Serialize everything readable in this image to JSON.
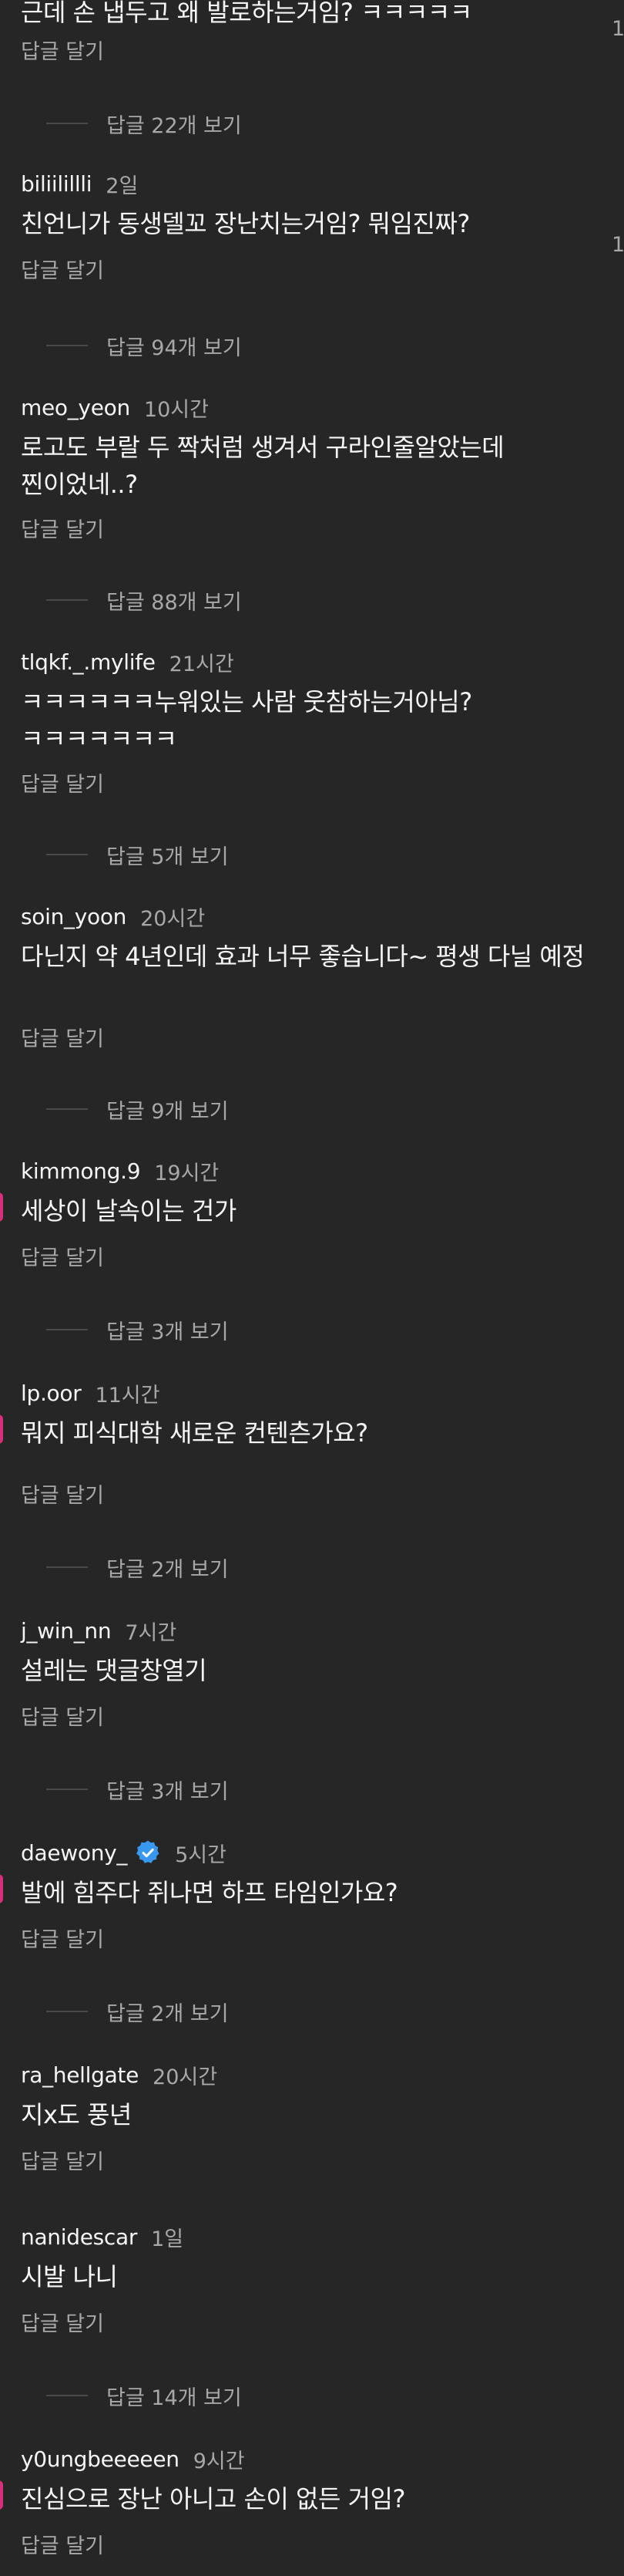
{
  "reply_label": "답글 달기",
  "top_partial": {
    "text": "근데 손 냅두고 왜 발로하는거임? ㅋㅋㅋㅋㅋ",
    "reply_label": "답글 달기",
    "view_replies": "답글 22개 보기",
    "side_count": "1"
  },
  "comments": [
    {
      "username": "biliilillli",
      "time": "2일",
      "text": "친언니가 동생델꼬 장난치는거임? 뭐임진짜?",
      "reply_label": "답글 달기",
      "view_replies": "답글 94개 보기",
      "side_count": "1"
    },
    {
      "username": "meo_yeon",
      "time": "10시간",
      "text": "로고도 부랄 두 짝처럼 생겨서 구라인줄알았는데 찐이었네..?",
      "reply_label": "답글 달기",
      "view_replies": "답글 88개 보기"
    },
    {
      "username": "tlqkf._.mylife",
      "time": "21시간",
      "text": "ㅋㅋㅋㅋㅋㅋ누워있는 사람 웃참하는거아님?ㅋㅋㅋㅋㅋㅋㅋ",
      "reply_label": "답글 달기",
      "view_replies": "답글 5개 보기"
    },
    {
      "username": "soin_yoon",
      "time": "20시간",
      "text": "다닌지 약 4년인데 효과 너무 좋습니다~ 평생 다닐 예정",
      "reply_label": "답글 달기",
      "view_replies": "답글 9개 보기"
    },
    {
      "username": "kimmong.9",
      "time": "19시간",
      "text": "세상이 날속이는 건가",
      "reply_label": "답글 달기",
      "view_replies": "답글 3개 보기"
    },
    {
      "username": "lp.oor",
      "time": "11시간",
      "text": "뭐지 피식대학 새로운 컨텐츤가요?",
      "reply_label": "답글 달기",
      "view_replies": "답글 2개 보기"
    },
    {
      "username": "j_win_nn",
      "time": "7시간",
      "text": "설레는 댓글창열기",
      "reply_label": "답글 달기",
      "view_replies": "답글 3개 보기"
    },
    {
      "username": "daewony_",
      "verified": true,
      "time": "5시간",
      "text": "발에 힘주다 쥐나면 하프 타임인가요?",
      "reply_label": "답글 달기",
      "view_replies": "답글 2개 보기"
    },
    {
      "username": "ra_hellgate",
      "time": "20시간",
      "text": "지x도 풍년",
      "reply_label": "답글 달기"
    },
    {
      "username": "nanidescar",
      "time": "1일",
      "text": "시발 나니",
      "reply_label": "답글 달기",
      "view_replies": "답글 14개 보기"
    },
    {
      "username": "y0ungbeeeeen",
      "time": "9시간",
      "text": "진심으로 장난 아니고 손이 없든 거임?",
      "reply_label": "답글 달기"
    }
  ],
  "colors": {
    "background": "#262626",
    "primary_text": "#f5f5f5",
    "secondary_text": "#a8a8a8",
    "verified_badge": "#3897f0",
    "pink_mark": "#d62f7c"
  },
  "icons": {
    "verified": "verified-badge-icon"
  }
}
